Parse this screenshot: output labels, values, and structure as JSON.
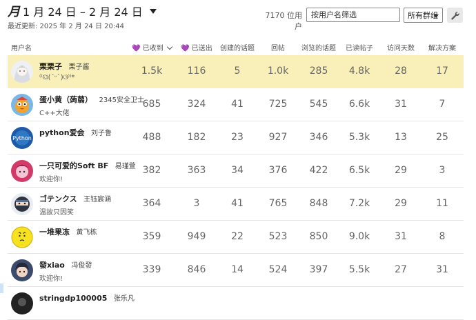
{
  "period": {
    "icon": "月",
    "range": "1 月 24 日 – 2 月 24 日"
  },
  "last_updated": "最近更新:  2025 年 2 月 24 日 20:44",
  "user_count": "7170 位用户",
  "search": {
    "placeholder": "按用户名筛选"
  },
  "group_filter": "所有群组",
  "columns": {
    "username": "用户名",
    "received": "已收到",
    "sent": "已送出",
    "topics_created": "创建的话题",
    "replies": "回帖",
    "topics_viewed": "浏览的话题",
    "posts_read": "已读帖子",
    "days_visited": "访问天数",
    "solutions": "解决方案"
  },
  "rows": [
    {
      "username": "栗栗子",
      "name": "栗子酱",
      "title": "⁽⁽ଘ(ˊᵕˋ)ଓ⁾⁾*",
      "avatar": "anime-girl",
      "highlight": true,
      "received": "1.5k",
      "sent": "116",
      "topics": "5",
      "replies": "1.0k",
      "viewed": "285",
      "read": "4.8k",
      "days": "28",
      "solutions": "17"
    },
    {
      "username": "蛋小黄（蒟蒻）",
      "name": "2345安全卫士",
      "title": "C++大佬",
      "avatar": "colorful-bird",
      "received": "685",
      "sent": "324",
      "topics": "41",
      "replies": "725",
      "viewed": "545",
      "read": "6.6k",
      "days": "31",
      "solutions": "7"
    },
    {
      "username": "python爱会",
      "name": "刘子鲁",
      "title": "",
      "avatar": "python-logo",
      "received": "488",
      "sent": "182",
      "topics": "23",
      "replies": "927",
      "viewed": "346",
      "read": "5.3k",
      "days": "13",
      "solutions": "25"
    },
    {
      "username": "一只可爱的Soft BF",
      "name": "易瑾萱",
      "title": "欢迎你!",
      "avatar": "pink-character",
      "received": "382",
      "sent": "363",
      "topics": "34",
      "replies": "376",
      "viewed": "422",
      "read": "6.5k",
      "days": "29",
      "solutions": "3"
    },
    {
      "username": "ゴテンクス",
      "name": "王钰宸涵",
      "title": "温故只因笑",
      "avatar": "ninja",
      "received": "364",
      "sent": "3",
      "topics": "41",
      "replies": "765",
      "viewed": "848",
      "read": "7.2k",
      "days": "29",
      "solutions": "11"
    },
    {
      "username": "一堆果冻",
      "name": "黄飞栋",
      "title": "",
      "avatar": "yellow-face",
      "received": "359",
      "sent": "949",
      "topics": "22",
      "replies": "523",
      "viewed": "850",
      "read": "9.0k",
      "days": "31",
      "solutions": "8"
    },
    {
      "username": "發xiao",
      "name": "冯俊發",
      "title": "欢迎你!",
      "avatar": "anime-boy",
      "received": "339",
      "sent": "846",
      "topics": "14",
      "replies": "524",
      "viewed": "397",
      "read": "5.5k",
      "days": "27",
      "solutions": "31"
    },
    {
      "username": "stringdp100005",
      "name": "张乐凡",
      "title": "",
      "avatar": "dark-person",
      "received": "",
      "sent": "",
      "topics": "",
      "replies": "",
      "viewed": "",
      "read": "",
      "days": "",
      "solutions": ""
    }
  ],
  "colors": {
    "highlight": "#f9efb8",
    "heart": "#b163d6"
  }
}
